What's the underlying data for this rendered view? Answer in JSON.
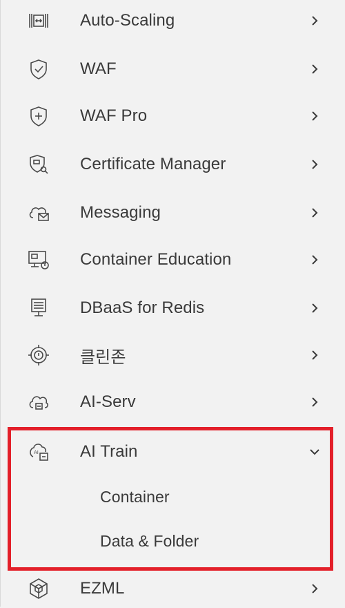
{
  "menu": {
    "items": [
      {
        "label": "Auto-Scaling",
        "icon": "auto-scaling-icon",
        "expanded": false
      },
      {
        "label": "WAF",
        "icon": "shield-check-icon",
        "expanded": false
      },
      {
        "label": "WAF Pro",
        "icon": "shield-plus-icon",
        "expanded": false
      },
      {
        "label": "Certificate Manager",
        "icon": "certificate-icon",
        "expanded": false
      },
      {
        "label": "Messaging",
        "icon": "cloud-mail-icon",
        "expanded": false
      },
      {
        "label": "Container Education",
        "icon": "monitor-education-icon",
        "expanded": false
      },
      {
        "label": "DBaaS for Redis",
        "icon": "database-monitor-icon",
        "expanded": false
      },
      {
        "label": "클린존",
        "icon": "target-icon",
        "expanded": false
      },
      {
        "label": "AI-Serv",
        "icon": "cloud-ai-icon",
        "expanded": false
      },
      {
        "label": "AI Train",
        "icon": "ai-train-icon",
        "expanded": true,
        "children": [
          {
            "label": "Container"
          },
          {
            "label": "Data & Folder"
          }
        ]
      },
      {
        "label": "EZML",
        "icon": "cube-icon",
        "expanded": false
      }
    ]
  },
  "colors": {
    "background": "#f2f2f2",
    "text": "#3a3a3a",
    "icon": "#4a4a4a",
    "highlight_border": "#e3202a"
  }
}
